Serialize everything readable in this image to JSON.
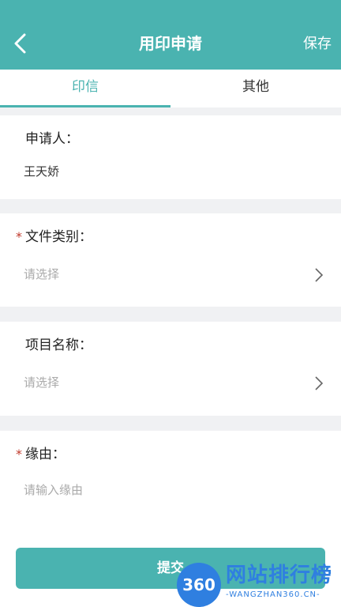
{
  "header": {
    "title": "用印申请",
    "save_label": "保存",
    "back_icon": "chevron-left-icon"
  },
  "tabs": [
    {
      "label": "印信",
      "active": true
    },
    {
      "label": "其他",
      "active": false
    }
  ],
  "form": {
    "applicant": {
      "label": "申请人：",
      "value": "王天娇"
    },
    "file_type": {
      "required_mark": "*",
      "label": "文件类别：",
      "placeholder": "请选择"
    },
    "project_name": {
      "label": "项目名称：",
      "placeholder": "请选择"
    },
    "reason": {
      "required_mark": "*",
      "label": "缘由：",
      "placeholder": "请输入缘由"
    }
  },
  "submit_label": "提交",
  "watermark": {
    "badge": "360",
    "title": "网站排行榜",
    "subtitle": "-WANGZHAN360.CN-"
  },
  "colors": {
    "accent": "#4ab3b0",
    "required": "#c0392b",
    "placeholder": "#aaaaaa"
  }
}
